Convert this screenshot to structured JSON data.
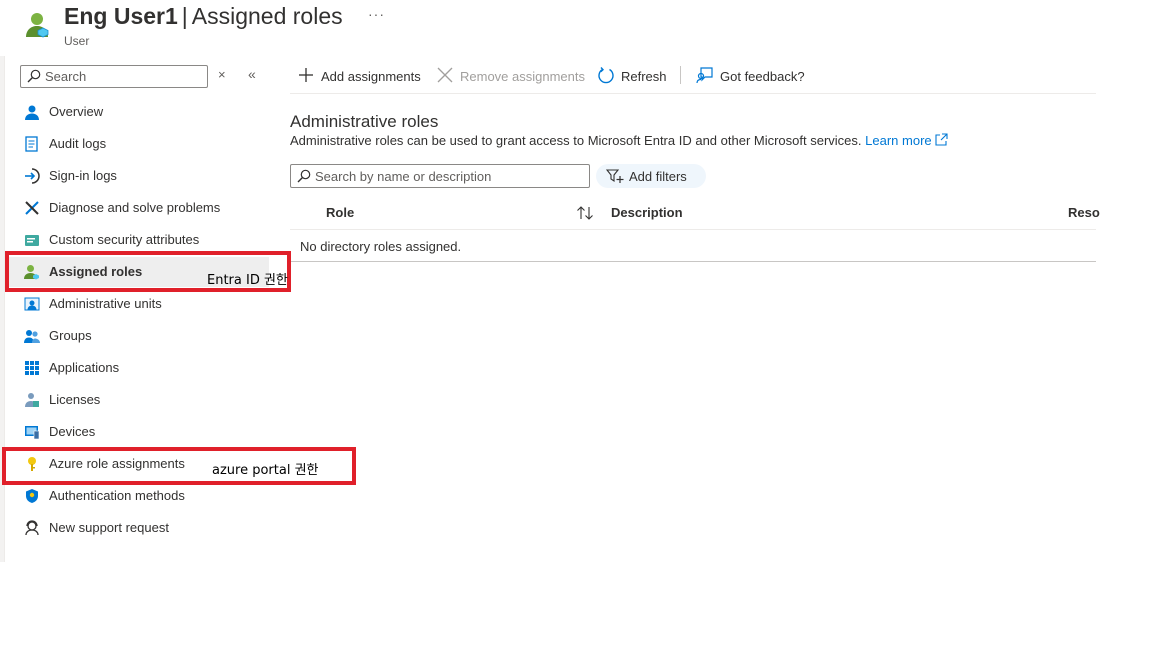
{
  "header": {
    "title_name": "Eng User1",
    "title_separator": "|",
    "title_page": "Assigned roles",
    "more": "···",
    "subtitle": "User"
  },
  "sidebar": {
    "search_placeholder": "Search",
    "clear": "×",
    "collapse": "«",
    "items": [
      {
        "label": "Overview",
        "icon": "user-icon"
      },
      {
        "label": "Audit logs",
        "icon": "audit-log-icon"
      },
      {
        "label": "Sign-in logs",
        "icon": "sign-in-icon"
      },
      {
        "label": "Diagnose and solve problems",
        "icon": "wrench-icon"
      },
      {
        "label": "Custom security attributes",
        "icon": "attributes-icon"
      },
      {
        "label": "Assigned roles",
        "icon": "user-role-icon",
        "selected": true
      },
      {
        "label": "Administrative units",
        "icon": "admin-units-icon"
      },
      {
        "label": "Groups",
        "icon": "groups-icon"
      },
      {
        "label": "Applications",
        "icon": "apps-grid-icon"
      },
      {
        "label": "Licenses",
        "icon": "license-icon"
      },
      {
        "label": "Devices",
        "icon": "device-icon"
      },
      {
        "label": "Azure role assignments",
        "icon": "key-icon"
      },
      {
        "label": "Authentication methods",
        "icon": "shield-icon"
      },
      {
        "label": "New support request",
        "icon": "support-icon"
      }
    ]
  },
  "toolbar": {
    "add": "Add assignments",
    "remove": "Remove assignments",
    "refresh": "Refresh",
    "feedback": "Got feedback?"
  },
  "main": {
    "section_title": "Administrative roles",
    "section_desc": "Administrative roles can be used to grant access to Microsoft Entra ID and other Microsoft services.",
    "learn_more": "Learn more",
    "filter_placeholder": "Search by name or description",
    "add_filters": "Add filters",
    "columns": [
      "Role",
      "Description",
      "Reso"
    ],
    "empty_message": "No directory roles assigned."
  },
  "annotations": {
    "entra": "Entra ID 권한",
    "azure": "azure portal 권한"
  },
  "colors": {
    "accent": "#0078d4",
    "highlight": "#e0202a",
    "selected_bg": "#eeeeee"
  }
}
